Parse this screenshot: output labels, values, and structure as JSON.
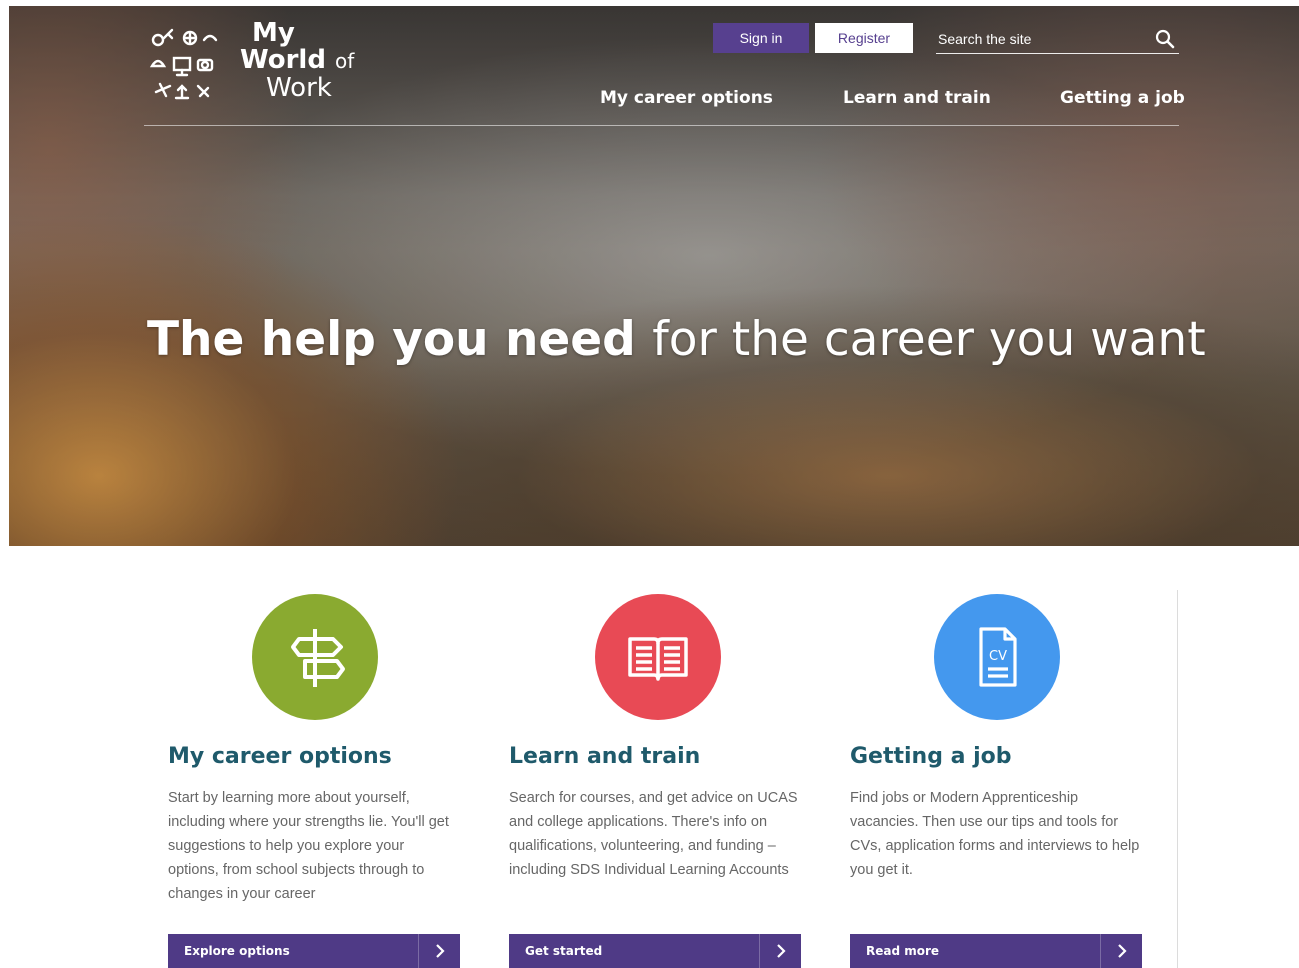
{
  "header": {
    "logo": {
      "line1": "My",
      "line2": "World",
      "line2_small": "of",
      "line3": "Work"
    },
    "signin_label": "Sign in",
    "register_label": "Register",
    "search": {
      "placeholder": "Search the site",
      "value": "",
      "icon": "search-icon"
    },
    "nav": [
      {
        "label": "My career options"
      },
      {
        "label": "Learn and train"
      },
      {
        "label": "Getting a job"
      }
    ]
  },
  "hero": {
    "title_bold": "The help you need",
    "title_rest": "for the career you want"
  },
  "cards": [
    {
      "title": "My career options",
      "description": "Start by learning more about yourself, including where your strengths lie. You'll get suggestions to help you explore your options, from school subjects through to changes in your career",
      "button_label": "Explore options",
      "icon": "signpost-icon",
      "color": "#8aaa30"
    },
    {
      "title": "Learn and train",
      "description": "Search for courses, and get advice on UCAS and college applications. There's info on qualifications, volunteering, and funding – including SDS Individual Learning Accounts",
      "button_label": "Get started",
      "icon": "open-book-icon",
      "color": "#e84a55"
    },
    {
      "title": "Getting a job",
      "description": "Find jobs or Modern Apprenticeship vacancies. Then use our tips and tools for CVs, application forms and interviews to help you get it.",
      "button_label": "Read more",
      "icon": "cv-document-icon",
      "color": "#4498ee"
    }
  ],
  "colors": {
    "purple_button": "#57408f",
    "card_button": "#4f3a86",
    "title_teal": "#1f5a6b"
  }
}
